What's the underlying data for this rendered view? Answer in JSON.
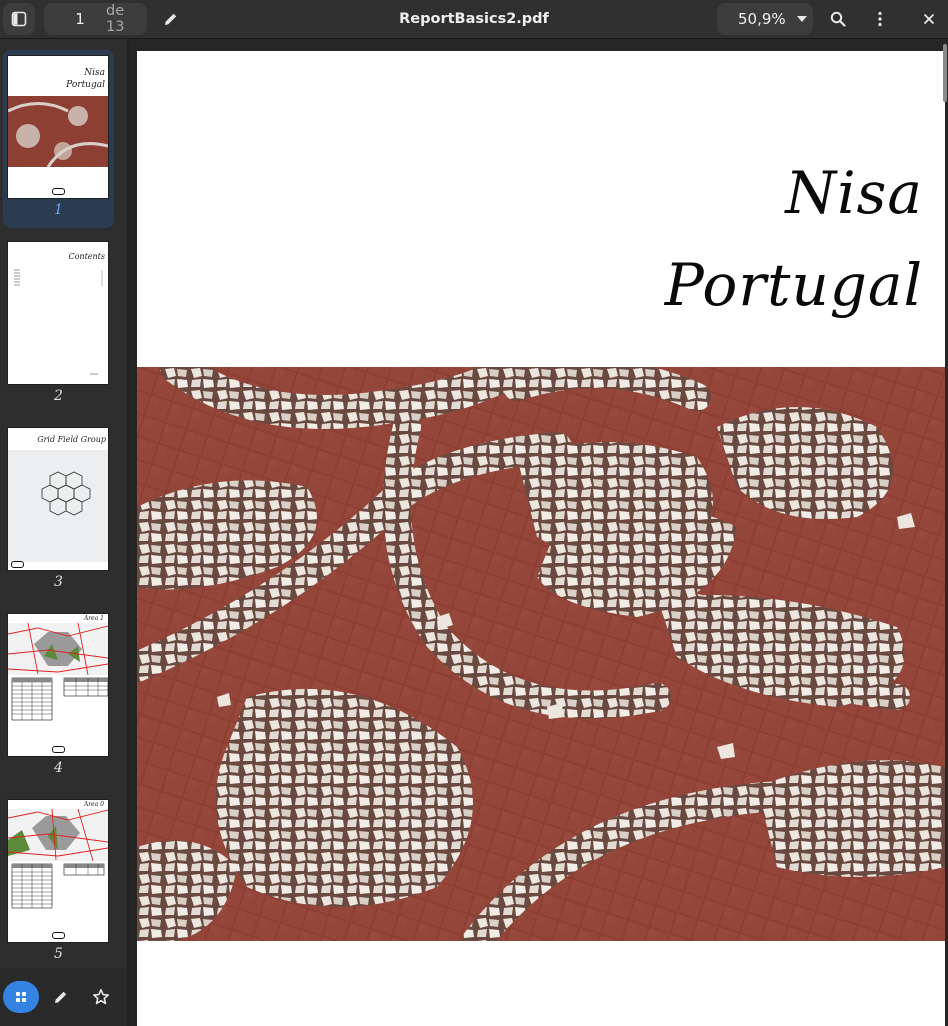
{
  "header": {
    "current_page": "1",
    "page_total": "de 13",
    "title": "ReportBasics2.pdf",
    "zoom": "50,9%",
    "icons": [
      "sidebar-toggle-icon",
      "pencil-icon",
      "search-icon",
      "kebab-menu-icon",
      "close-icon"
    ]
  },
  "sidebar": {
    "thumbnails": [
      {
        "label": "1",
        "title_line1": "Nisa",
        "title_line2": "Portugal"
      },
      {
        "label": "2",
        "title": "Contents"
      },
      {
        "label": "3",
        "title": "Grid Field Group"
      },
      {
        "label": "4",
        "title": "Area 1"
      },
      {
        "label": "5",
        "title": "Area 0"
      }
    ],
    "footer_icons": [
      "grid-icon",
      "pencil-icon",
      "star-icon"
    ]
  },
  "document": {
    "title_line1": "Nisa",
    "title_line2": "Portugal"
  },
  "colors": {
    "accent": "#3584e4",
    "selected_bg": "#2b3b52",
    "brick": "#8e3f33"
  }
}
